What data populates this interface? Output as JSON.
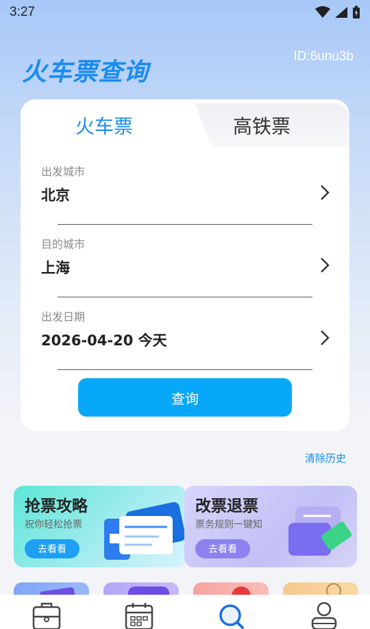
{
  "status_bar": {
    "time": "3:27"
  },
  "header": {
    "title": "火车票查询",
    "id_label": "ID:6unu3b"
  },
  "tabs": [
    {
      "label": "火车票",
      "active": true
    },
    {
      "label": "高铁票",
      "active": false
    }
  ],
  "form": {
    "departure": {
      "label": "出发城市",
      "value": "北京"
    },
    "destination": {
      "label": "目的城市",
      "value": "上海"
    },
    "date": {
      "label": "出发日期",
      "value": "2026-04-20 今天"
    },
    "submit_label": "查询"
  },
  "clear_history_label": "清除历史",
  "promos": [
    {
      "title": "抢票攻略",
      "subtitle": "祝你轻松抢票",
      "button": "去看看"
    },
    {
      "title": "改票退票",
      "subtitle": "票务规则一键知",
      "button": "去看看"
    }
  ],
  "bottom_nav": [
    {
      "icon": "toolbox-icon"
    },
    {
      "icon": "calendar-icon"
    },
    {
      "icon": "search-icon",
      "active": true
    },
    {
      "icon": "profile-icon"
    }
  ],
  "colors": {
    "accent": "#1a8cf0",
    "button": "#08a8f8"
  }
}
